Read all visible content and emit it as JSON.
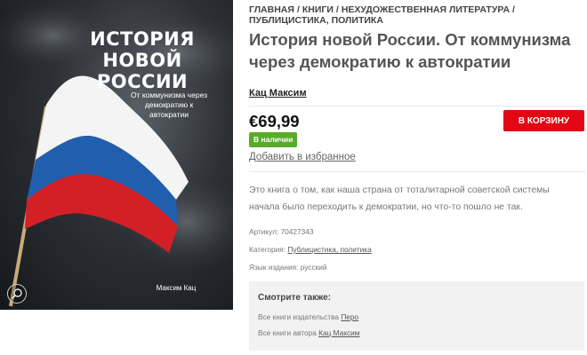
{
  "cover": {
    "title_line1": "ИСТОРИЯ",
    "title_line2": "НОВОЙ",
    "title_line3": "РОССИИ",
    "subtitle": "От коммунизма через демократию к автократии",
    "author": "Максим Кац",
    "zoom_icon": "zoom-in-icon"
  },
  "breadcrumb": {
    "items": [
      "ГЛАВНАЯ",
      "КНИГИ",
      "НЕХУДОЖЕСТВЕННАЯ ЛИТЕРАТУРА",
      "ПУБЛИЦИСТИКА, ПОЛИТИКА"
    ],
    "separator": "/"
  },
  "product": {
    "title": "История новой России. От коммунизма через демократию к автократии",
    "author": "Кац Максим",
    "price": "€69,99",
    "stock_status": "В наличии",
    "add_to_cart": "В КОРЗИНУ",
    "add_to_wishlist": "Добавить в избранное",
    "description": "Это книга о том, как наша страна от тоталитарной советской системы начала было переходить к демократии, но что-то пошло не так."
  },
  "meta": {
    "sku_label": "Артикул:",
    "sku_value": "70427343",
    "category_label": "Категория:",
    "category_value": "Публицистика, политика",
    "language_label": "Язык издания:",
    "language_value": "русский"
  },
  "see_also": {
    "title": "Смотрите также:",
    "publisher_label": "Все книги издательства",
    "publisher_value": "Перо",
    "author_label": "Все книги автора",
    "author_value": "Кац Максим"
  },
  "colors": {
    "accent_red": "#e30613",
    "stock_green": "#5aab2b",
    "flag_white": "#ffffff",
    "flag_blue": "#1f5fae",
    "flag_red": "#d32027"
  }
}
